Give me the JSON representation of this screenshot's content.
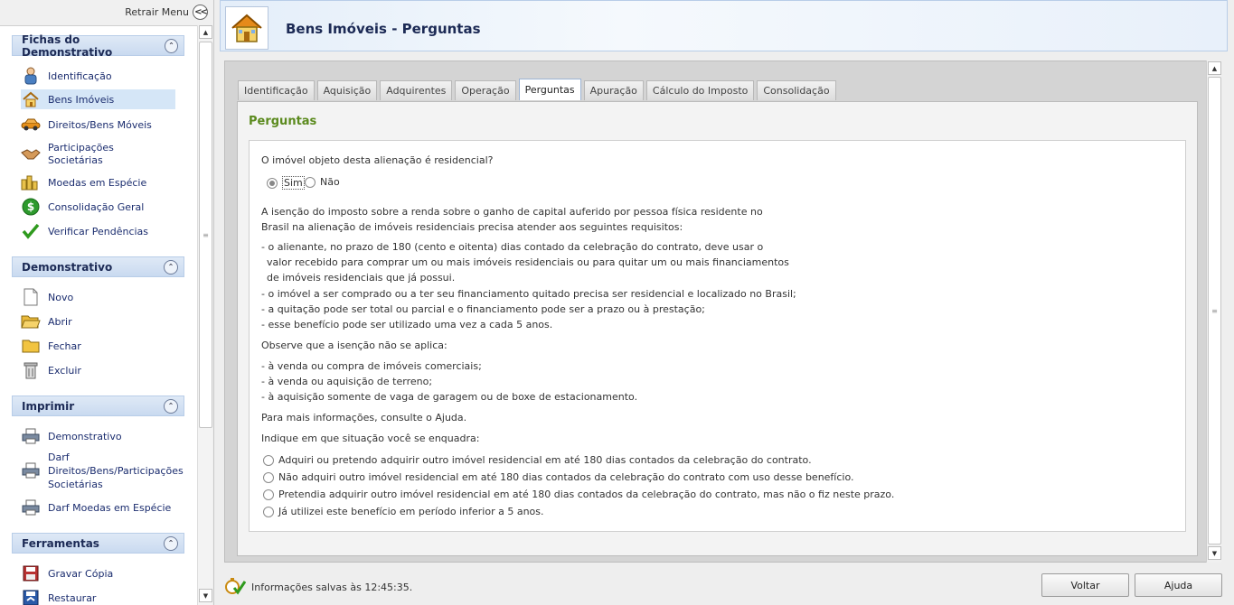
{
  "sidebar": {
    "collapse_label": "Retrair Menu",
    "sections": [
      {
        "title": "Fichas do Demonstrativo",
        "items": [
          "Identificação",
          "Bens Imóveis",
          "Direitos/Bens Móveis",
          "Participações Societárias",
          "Moedas em Espécie",
          "Consolidação Geral",
          "Verificar Pendências"
        ]
      },
      {
        "title": "Demonstrativo",
        "items": [
          "Novo",
          "Abrir",
          "Fechar",
          "Excluir"
        ]
      },
      {
        "title": "Imprimir",
        "items": [
          "Demonstrativo",
          "Darf Direitos/Bens/Participações Societárias",
          "Darf Moedas em Espécie"
        ]
      },
      {
        "title": "Ferramentas",
        "items": [
          "Gravar Cópia",
          "Restaurar"
        ]
      }
    ],
    "selected_item": "Bens Imóveis"
  },
  "header": {
    "title": "Bens Imóveis - Perguntas"
  },
  "tabs": [
    "Identificação",
    "Aquisição",
    "Adquirentes",
    "Operação",
    "Perguntas",
    "Apuração",
    "Cálculo do Imposto",
    "Consolidação"
  ],
  "active_tab": "Perguntas",
  "panel": {
    "title": "Perguntas",
    "question1": "O imóvel objeto desta alienação é residencial?",
    "q1_options": [
      "Sim",
      "Não"
    ],
    "q1_selected": "Sim",
    "text_lines": [
      "A isenção do imposto sobre a renda sobre o ganho de capital auferido por pessoa física residente no",
      "Brasil na alienação de imóveis residenciais precisa atender aos seguintes requisitos:",
      "- o alienante, no prazo de 180 (cento e oitenta) dias contado da celebração do contrato, deve usar o",
      "  valor recebido para comprar um ou mais imóveis residenciais ou para quitar um ou mais financiamentos",
      "  de imóveis residenciais que já possui.",
      "- o imóvel a ser comprado ou a ter seu financiamento quitado precisa ser residencial e localizado no Brasil;",
      "- a quitação pode ser total ou parcial e o financiamento pode ser a prazo ou à prestação;",
      "- esse benefício pode ser utilizado uma vez a cada 5 anos.",
      "Observe que a isenção não se aplica:",
      "- à venda ou compra de imóveis comerciais;",
      "- à venda ou aquisição de terreno;",
      "- à aquisição somente de vaga de garagem ou de boxe de estacionamento.",
      "Para mais informações, consulte o Ajuda.",
      "Indique em que situação você se enquadra:"
    ],
    "situation_options": [
      "Adquiri ou pretendo adquirir outro imóvel residencial em até 180 dias contados da celebração do contrato.",
      "Não adquiri outro imóvel residencial em até 180 dias contados da celebração do contrato com uso desse benefício.",
      "Pretendia adquirir outro imóvel residencial em até 180 dias contados da celebração do contrato, mas não o fiz neste prazo.",
      "Já utilizei este benefício em período inferior a 5 anos."
    ]
  },
  "status": {
    "text": "Informações salvas às 12:45:35."
  },
  "buttons": {
    "back": "Voltar",
    "help": "Ajuda"
  }
}
